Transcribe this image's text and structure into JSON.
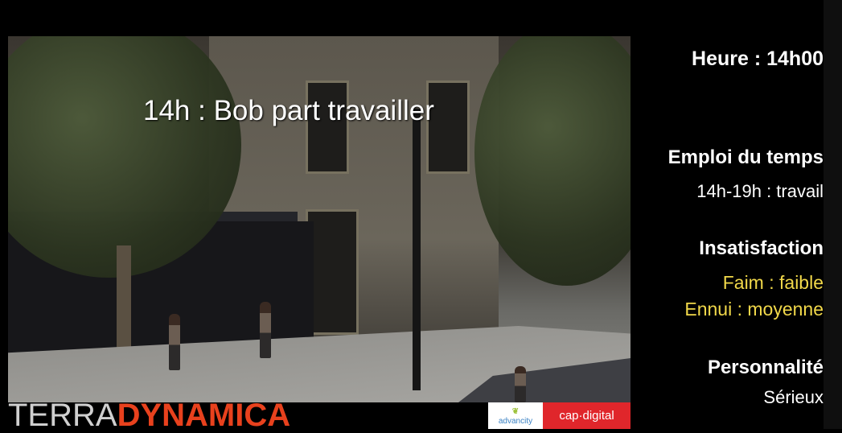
{
  "video": {
    "caption": "14h : Bob part travailler"
  },
  "panel": {
    "heure": "Heure : 14h00",
    "emploi_title": "Emploi du temps",
    "emploi_value": "14h-19h : travail",
    "insatisfaction_title": "Insatisfaction",
    "faim": "Faim : faible",
    "ennui": "Ennui : moyenne",
    "personnalite_title": "Personnalité",
    "personnalite_value": "Sérieux"
  },
  "footer": {
    "logo_part1": "TERRA",
    "logo_part2": "DYNAMICA",
    "advancity_line1": "advancity",
    "capdigital": "cap·digital"
  },
  "colors": {
    "accent_red": "#e8411d",
    "yellow_text": "#f1d84a",
    "capdigital_bg": "#e0262b"
  }
}
